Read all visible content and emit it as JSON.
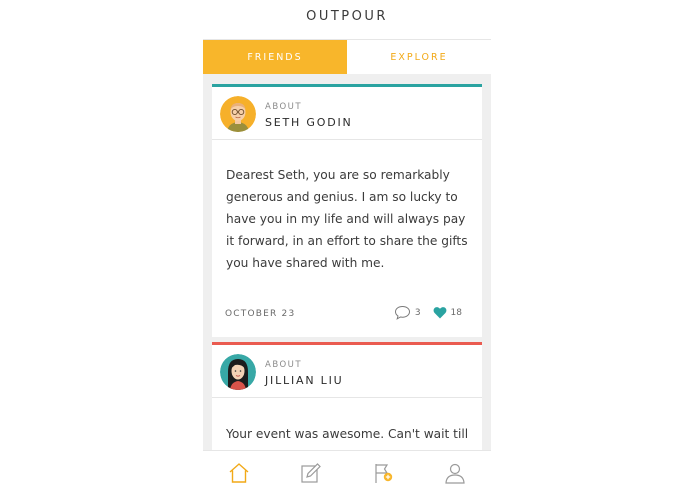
{
  "app": {
    "title": "OUTPOUR"
  },
  "tabs": [
    {
      "label": "FRIENDS",
      "active": true
    },
    {
      "label": "EXPLORE",
      "active": false
    }
  ],
  "posts": [
    {
      "about_label": "ABOUT",
      "name": "SETH GODIN",
      "message": "Dearest Seth, you are so remarkably generous and genius. I am so lucky to have you in my life and will always pay it forward, in an effort to share the gifts you have shared with me.",
      "date": "OCTOBER 23",
      "comments": "3",
      "likes": "18",
      "accent_color": "#2aa3a1"
    },
    {
      "about_label": "ABOUT",
      "name": "JILLIAN LIU",
      "message": "Your event was awesome. Can't wait till",
      "accent_color": "#ea5b50"
    }
  ],
  "nav": [
    {
      "icon": "home-icon",
      "active": true
    },
    {
      "icon": "compose-icon",
      "active": false
    },
    {
      "icon": "flag-add-icon",
      "active": false
    },
    {
      "icon": "profile-icon",
      "active": false
    }
  ],
  "colors": {
    "accent": "#f8b62b",
    "teal": "#2aa3a1",
    "red": "#ea5b50"
  }
}
